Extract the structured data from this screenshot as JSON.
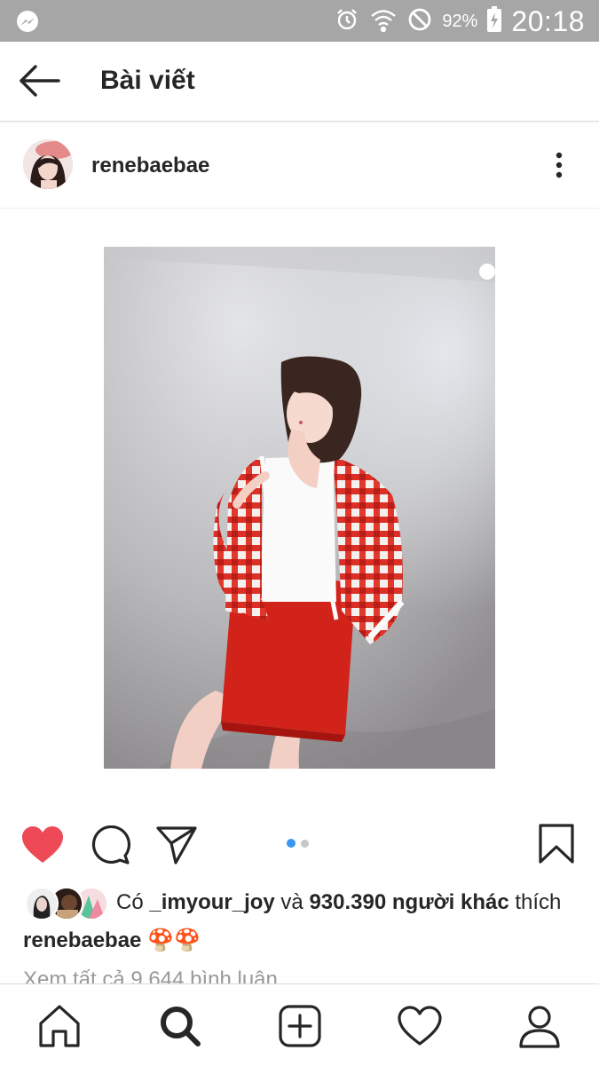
{
  "status_bar": {
    "left_icon": "messenger-icon",
    "icons": [
      "alarm-icon",
      "wifi-icon",
      "do-not-disturb-icon"
    ],
    "battery": "92%",
    "time": "20:18"
  },
  "app_bar": {
    "back_icon": "arrow-left-icon",
    "title": "Bài viết"
  },
  "post": {
    "username": "renebaebae",
    "menu_icon": "more-vertical-icon",
    "carousel": {
      "count": 2,
      "active_index": 0
    },
    "actions": {
      "like_icon": "heart-filled-icon",
      "comment_icon": "comment-icon",
      "share_icon": "send-icon",
      "save_icon": "bookmark-icon",
      "liked_color": "#ed4956"
    },
    "likes": {
      "prefix": "Có",
      "user": "_imyour_joy",
      "conj": "và",
      "others": "930.390 người khác",
      "suffix": "thích"
    },
    "caption": {
      "username": "renebaebae",
      "text": "🍄🍄"
    },
    "comments_link": "Xem tất cả 9.644 bình luận"
  },
  "nav_bar": {
    "items": [
      "home-icon",
      "search-icon",
      "add-post-icon",
      "activity-heart-icon",
      "profile-icon"
    ],
    "active": "search-icon"
  },
  "colors": {
    "status_bar": "#a6a6a6",
    "link_blue": "#3897f0",
    "text": "#262626",
    "muted": "#999999"
  }
}
